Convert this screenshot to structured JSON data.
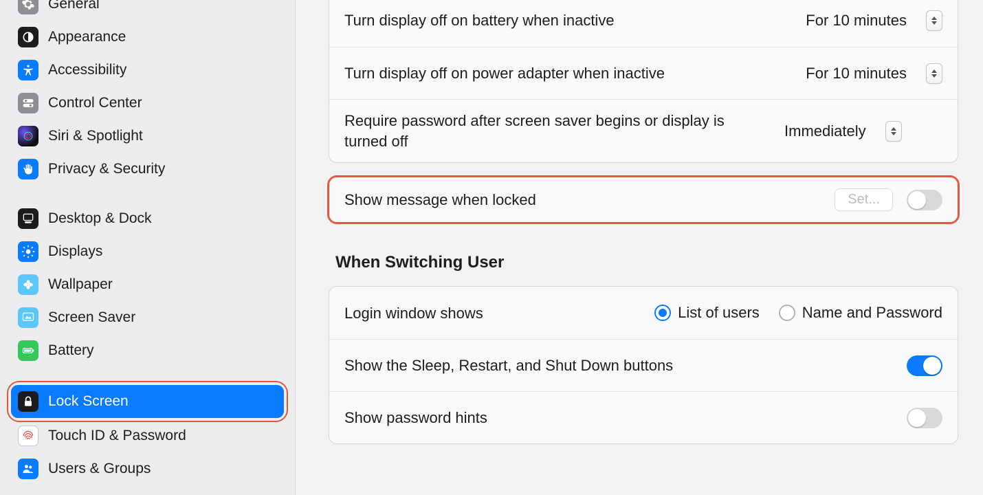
{
  "sidebar": {
    "items": [
      {
        "id": "general",
        "label": "General"
      },
      {
        "id": "appearance",
        "label": "Appearance"
      },
      {
        "id": "accessibility",
        "label": "Accessibility"
      },
      {
        "id": "controlcenter",
        "label": "Control Center"
      },
      {
        "id": "siri",
        "label": "Siri & Spotlight"
      },
      {
        "id": "privacy",
        "label": "Privacy & Security"
      },
      {
        "id": "desktop",
        "label": "Desktop & Dock"
      },
      {
        "id": "displays",
        "label": "Displays"
      },
      {
        "id": "wallpaper",
        "label": "Wallpaper"
      },
      {
        "id": "screensaver",
        "label": "Screen Saver"
      },
      {
        "id": "battery",
        "label": "Battery"
      },
      {
        "id": "lockscreen",
        "label": "Lock Screen"
      },
      {
        "id": "touchid",
        "label": "Touch ID & Password"
      },
      {
        "id": "users",
        "label": "Users & Groups"
      }
    ]
  },
  "main": {
    "rows": {
      "battery_off": {
        "label": "Turn display off on battery when inactive",
        "value": "For 10 minutes"
      },
      "adapter_off": {
        "label": "Turn display off on power adapter when inactive",
        "value": "For 10 minutes"
      },
      "require_pw": {
        "label": "Require password after screen saver begins or display is turned off",
        "value": "Immediately"
      },
      "show_msg": {
        "label": "Show message when locked",
        "button": "Set..."
      },
      "section": "When Switching User",
      "login_shows": {
        "label": "Login window shows",
        "opt1": "List of users",
        "opt2": "Name and Password"
      },
      "sleep_btns": {
        "label": "Show the Sleep, Restart, and Shut Down buttons"
      },
      "pw_hints": {
        "label": "Show password hints"
      }
    }
  }
}
